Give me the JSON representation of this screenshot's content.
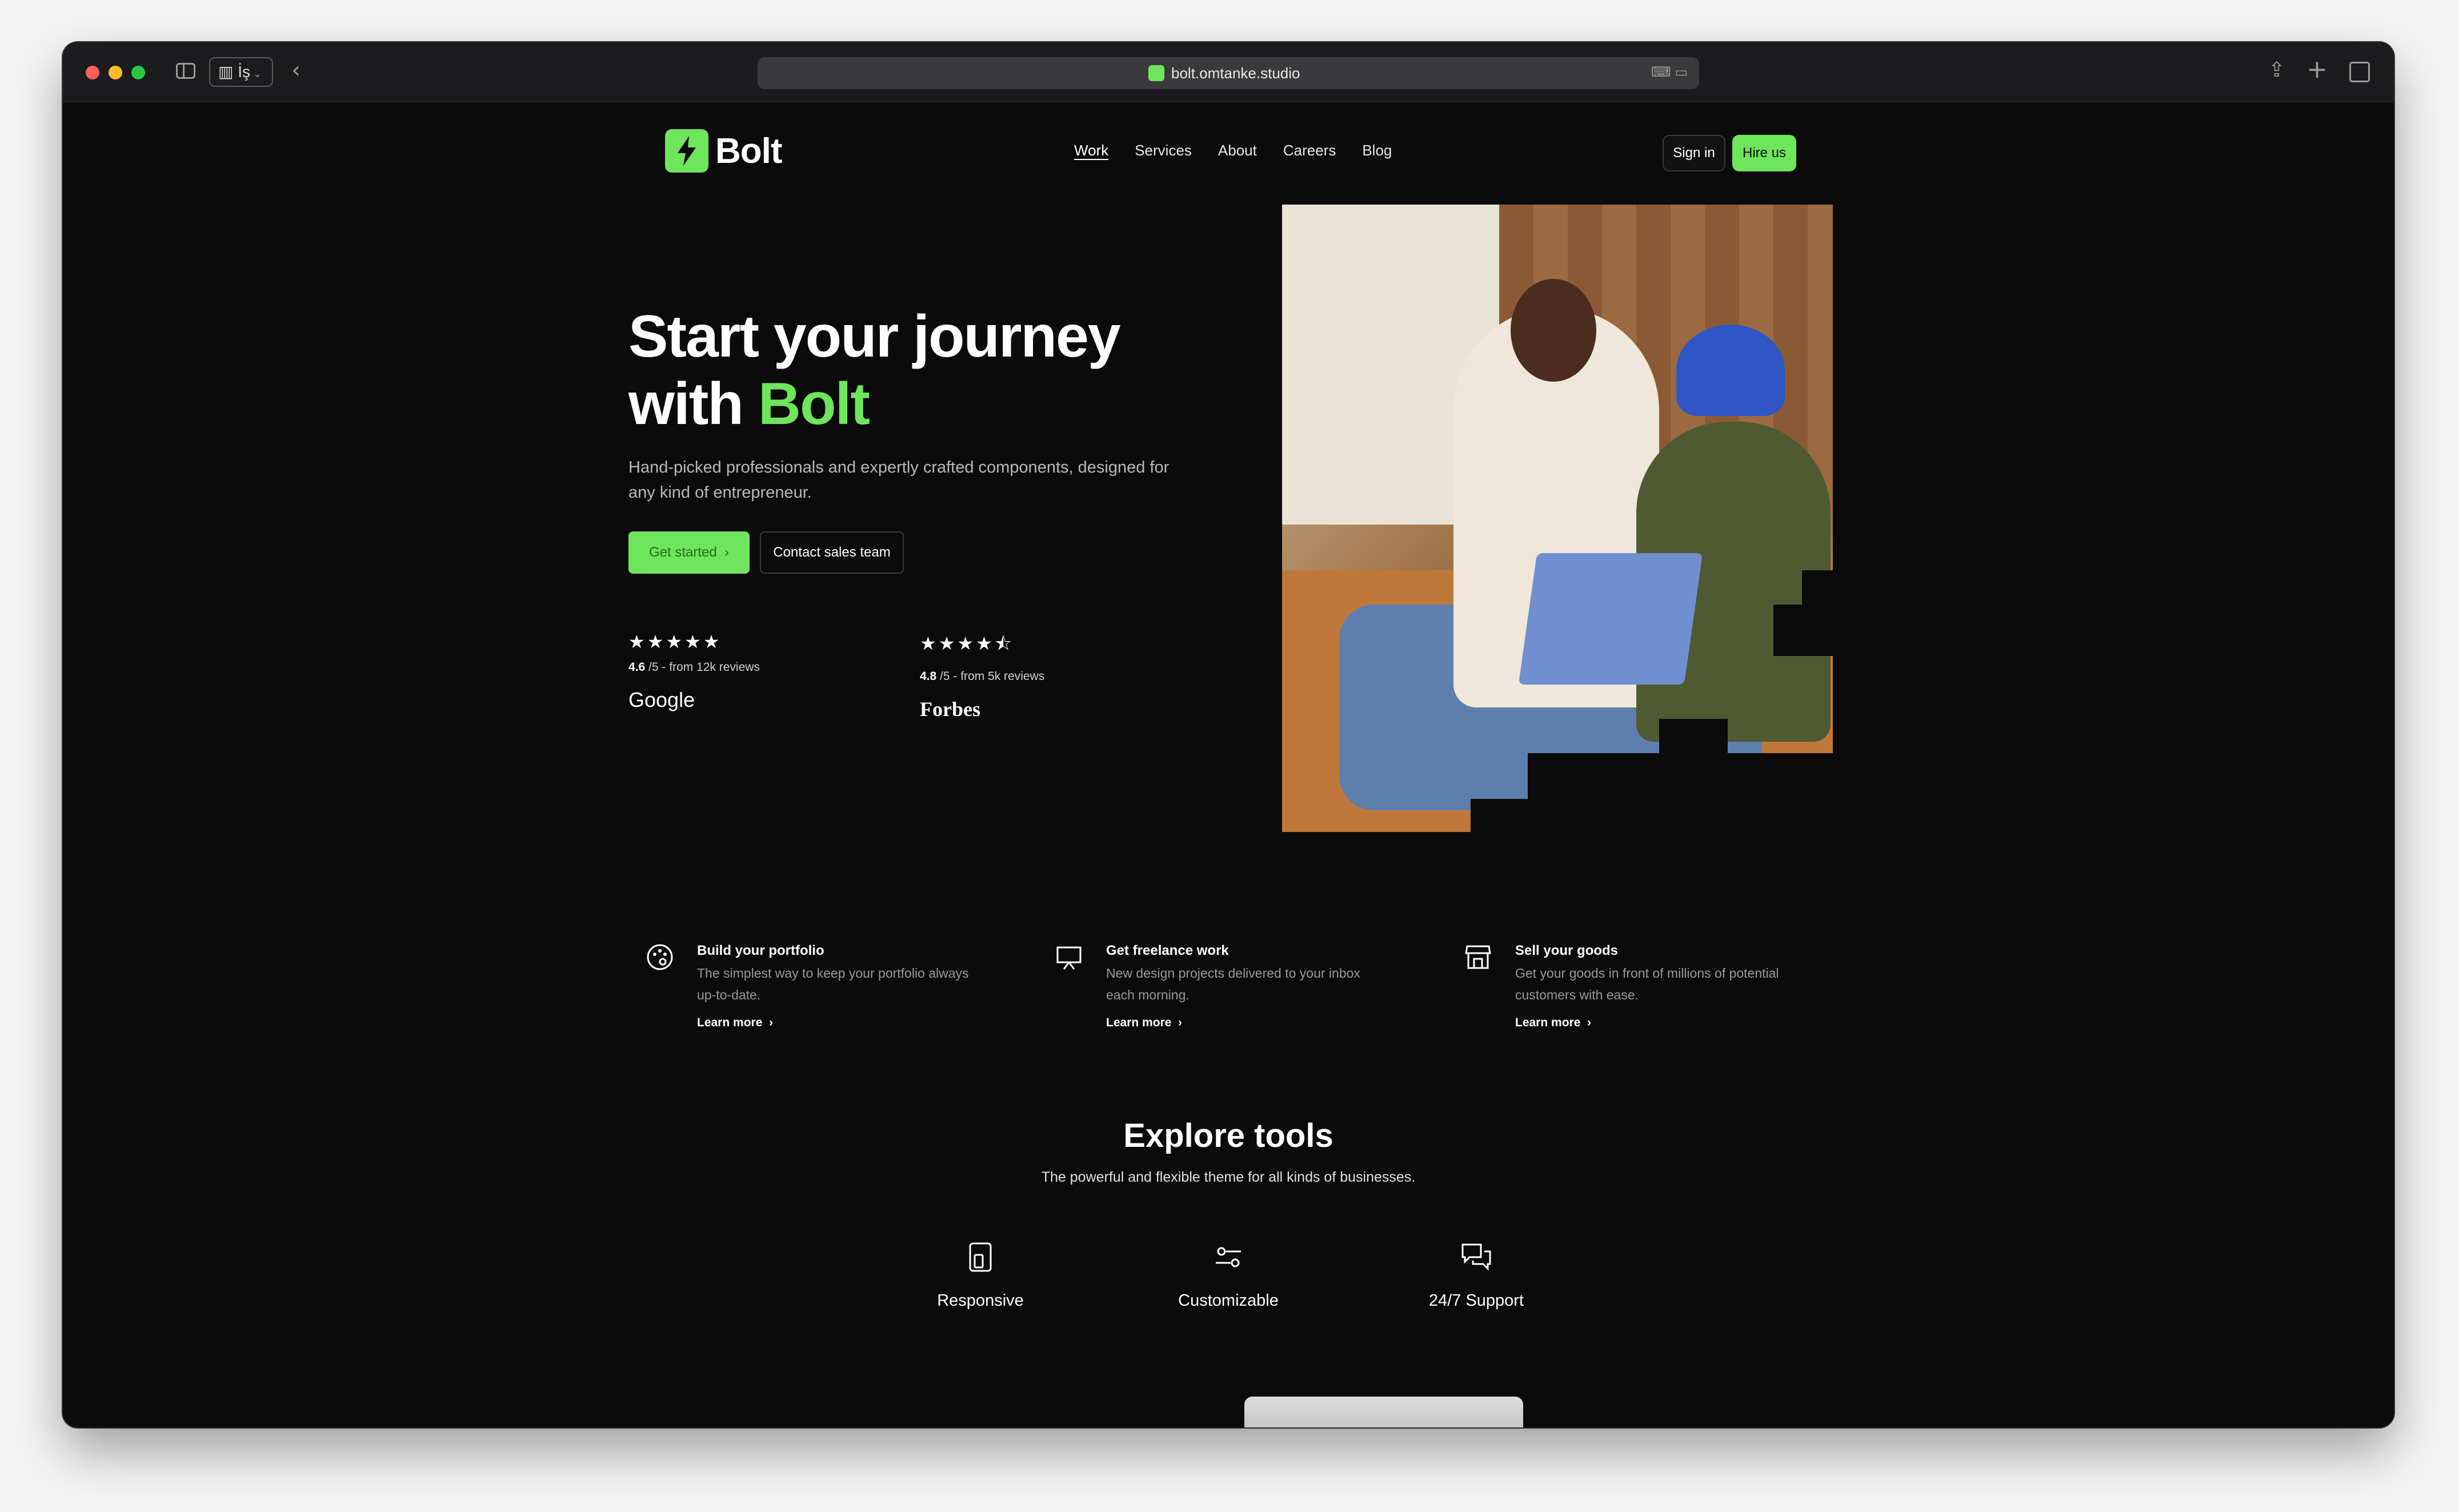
{
  "browser": {
    "profile_label": "İş",
    "url": "bolt.omtanke.studio"
  },
  "brand": {
    "name": "Bolt",
    "accent_color": "#6ee55c"
  },
  "nav": {
    "items": [
      {
        "label": "Work",
        "active": true
      },
      {
        "label": "Services",
        "active": false
      },
      {
        "label": "About",
        "active": false
      },
      {
        "label": "Careers",
        "active": false
      },
      {
        "label": "Blog",
        "active": false
      }
    ],
    "sign_in": "Sign in",
    "hire_us": "Hire us"
  },
  "hero": {
    "title_line1": "Start your journey",
    "title_line2_prefix": "with ",
    "title_line2_accent": "Bolt",
    "subtitle": "Hand-picked professionals and expertly crafted components, designed for any kind of entrepreneur.",
    "cta_primary": "Get started",
    "cta_secondary": "Contact sales team"
  },
  "ratings": [
    {
      "stars": "★★★★★",
      "score": "4.6",
      "suffix": " /5 - from 12k reviews",
      "brand": "Google"
    },
    {
      "stars": "★★★★⯪",
      "score": "4.8",
      "suffix": " /5 - from 5k reviews",
      "brand": "Forbes"
    }
  ],
  "features": [
    {
      "icon": "palette-icon",
      "title": "Build your portfolio",
      "desc": "The simplest way to keep your portfolio always up-to-date.",
      "link": "Learn more"
    },
    {
      "icon": "presentation-icon",
      "title": "Get freelance work",
      "desc": "New design projects delivered to your inbox each morning.",
      "link": "Learn more"
    },
    {
      "icon": "store-icon",
      "title": "Sell your goods",
      "desc": "Get your goods in front of millions of potential customers with ease.",
      "link": "Learn more"
    }
  ],
  "explore": {
    "title": "Explore tools",
    "subtitle": "The powerful and flexible theme for all kinds of businesses.",
    "tools": [
      {
        "icon": "devices-icon",
        "label": "Responsive"
      },
      {
        "icon": "sliders-icon",
        "label": "Customizable"
      },
      {
        "icon": "chat-icon",
        "label": "24/7 Support"
      }
    ]
  }
}
